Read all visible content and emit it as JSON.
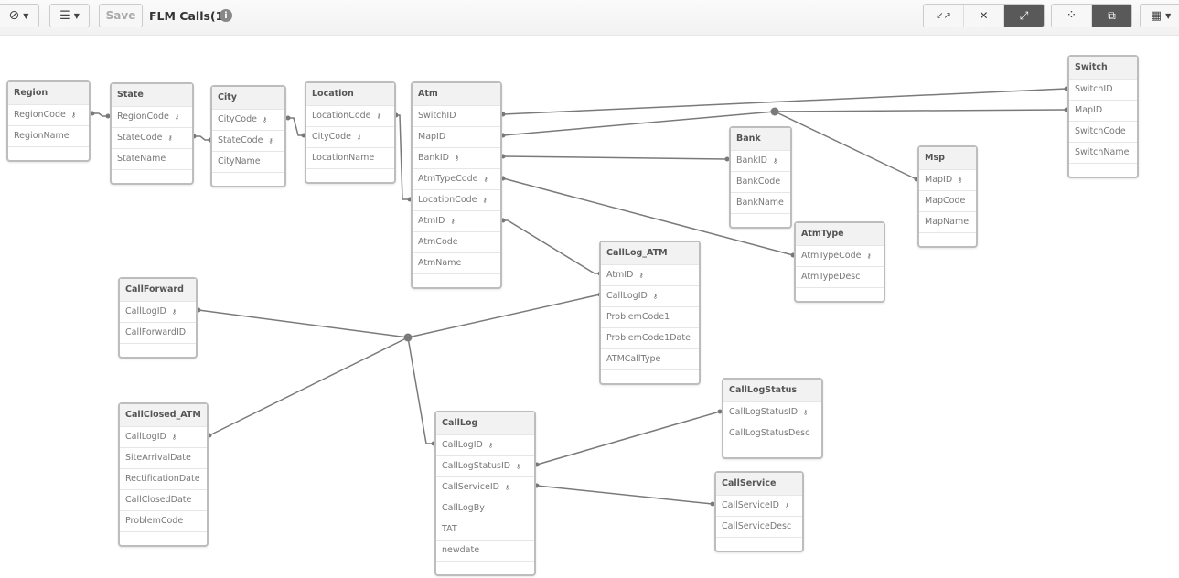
{
  "toolbar": {
    "nav_icon": "compass-icon",
    "view_icon": "list-icon",
    "save_label": "Save",
    "app_title": "FLM Calls(1)",
    "info_icon": "i",
    "layout_buttons": [
      {
        "name": "collapse-icon",
        "glyph": "↙↗",
        "active": false
      },
      {
        "name": "hide-icon",
        "glyph": "✕",
        "active": false
      },
      {
        "name": "expand-icon",
        "glyph": "⤢",
        "active": true
      }
    ],
    "view_buttons": [
      {
        "name": "internal-view-icon",
        "glyph": "⁘",
        "active": false
      },
      {
        "name": "source-view-icon",
        "glyph": "⧉",
        "active": true
      }
    ],
    "grid_icon": "grid-icon"
  },
  "tables": [
    {
      "id": "region",
      "name": "Region",
      "fields": [
        {
          "n": "RegionCode",
          "k": true
        },
        {
          "n": "RegionName",
          "k": false
        }
      ]
    },
    {
      "id": "state",
      "name": "State",
      "fields": [
        {
          "n": "RegionCode",
          "k": true
        },
        {
          "n": "StateCode",
          "k": true
        },
        {
          "n": "StateName",
          "k": false
        }
      ]
    },
    {
      "id": "city",
      "name": "City",
      "fields": [
        {
          "n": "CityCode",
          "k": true
        },
        {
          "n": "StateCode",
          "k": true
        },
        {
          "n": "CityName",
          "k": false
        }
      ]
    },
    {
      "id": "location",
      "name": "Location",
      "fields": [
        {
          "n": "LocationCode",
          "k": true
        },
        {
          "n": "CityCode",
          "k": true
        },
        {
          "n": "LocationName",
          "k": false
        }
      ]
    },
    {
      "id": "atm",
      "name": "Atm",
      "fields": [
        {
          "n": "SwitchID",
          "k": false
        },
        {
          "n": "MapID",
          "k": false
        },
        {
          "n": "BankID",
          "k": true
        },
        {
          "n": "AtmTypeCode",
          "k": true
        },
        {
          "n": "LocationCode",
          "k": true
        },
        {
          "n": "AtmID",
          "k": true
        },
        {
          "n": "AtmCode",
          "k": false
        },
        {
          "n": "AtmName",
          "k": false
        }
      ]
    },
    {
      "id": "bank",
      "name": "Bank",
      "fields": [
        {
          "n": "BankID",
          "k": true
        },
        {
          "n": "BankCode",
          "k": false
        },
        {
          "n": "BankName",
          "k": false
        }
      ]
    },
    {
      "id": "msp",
      "name": "Msp",
      "fields": [
        {
          "n": "MapID",
          "k": true
        },
        {
          "n": "MapCode",
          "k": false
        },
        {
          "n": "MapName",
          "k": false
        }
      ]
    },
    {
      "id": "switch",
      "name": "Switch",
      "fields": [
        {
          "n": "SwitchID",
          "k": false
        },
        {
          "n": "MapID",
          "k": false
        },
        {
          "n": "SwitchCode",
          "k": false
        },
        {
          "n": "SwitchName",
          "k": false
        }
      ]
    },
    {
      "id": "atmtype",
      "name": "AtmType",
      "fields": [
        {
          "n": "AtmTypeCode",
          "k": true
        },
        {
          "n": "AtmTypeDesc",
          "k": false
        }
      ]
    },
    {
      "id": "calllog_atm",
      "name": "CallLog_ATM",
      "fields": [
        {
          "n": "AtmID",
          "k": true
        },
        {
          "n": "CallLogID",
          "k": true
        },
        {
          "n": "ProblemCode1",
          "k": false
        },
        {
          "n": "ProblemCode1Date",
          "k": false
        },
        {
          "n": "ATMCallType",
          "k": false
        }
      ]
    },
    {
      "id": "callforward",
      "name": "CallForward",
      "fields": [
        {
          "n": "CallLogID",
          "k": true
        },
        {
          "n": "CallForwardID",
          "k": false
        }
      ]
    },
    {
      "id": "callclosed_atm",
      "name": "CallClosed_ATM",
      "fields": [
        {
          "n": "CallLogID",
          "k": true
        },
        {
          "n": "SiteArrivalDate",
          "k": false
        },
        {
          "n": "RectificationDate",
          "k": false
        },
        {
          "n": "CallClosedDate",
          "k": false
        },
        {
          "n": "ProblemCode",
          "k": false
        }
      ]
    },
    {
      "id": "calllog",
      "name": "CallLog",
      "fields": [
        {
          "n": "CallLogID",
          "k": true
        },
        {
          "n": "CallLogStatusID",
          "k": true
        },
        {
          "n": "CallServiceID",
          "k": true
        },
        {
          "n": "CallLogBy",
          "k": false
        },
        {
          "n": "TAT",
          "k": false
        },
        {
          "n": "newdate",
          "k": false
        }
      ]
    },
    {
      "id": "calllogstatus",
      "name": "CallLogStatus",
      "fields": [
        {
          "n": "CallLogStatusID",
          "k": true
        },
        {
          "n": "CallLogStatusDesc",
          "k": false
        }
      ]
    },
    {
      "id": "callservice",
      "name": "CallService",
      "fields": [
        {
          "n": "CallServiceID",
          "k": true
        },
        {
          "n": "CallServiceDesc",
          "k": false
        }
      ]
    }
  ],
  "associations": [
    {
      "from": "region.RegionCode",
      "to": "state.RegionCode"
    },
    {
      "from": "state.StateCode",
      "to": "city.StateCode"
    },
    {
      "from": "city.CityCode",
      "to": "location.CityCode"
    },
    {
      "from": "location.LocationCode",
      "to": "atm.LocationCode"
    },
    {
      "from": "atm.SwitchID",
      "to": "switch.SwitchID"
    },
    {
      "from": "atm.MapID",
      "to": "switch.MapID",
      "via": "msp.MapID"
    },
    {
      "from": "atm.BankID",
      "to": "bank.BankID"
    },
    {
      "from": "atm.AtmTypeCode",
      "to": "atmtype.AtmTypeCode"
    },
    {
      "from": "atm.AtmID",
      "to": "calllog_atm.AtmID"
    },
    {
      "from": "callforward.CallLogID",
      "to": "calllog_atm.CallLogID",
      "via": "calllog.CallLogID, callclosed_atm.CallLogID"
    },
    {
      "from": "calllog.CallLogStatusID",
      "to": "calllogstatus.CallLogStatusID"
    },
    {
      "from": "calllog.CallServiceID",
      "to": "callservice.CallServiceID"
    }
  ]
}
